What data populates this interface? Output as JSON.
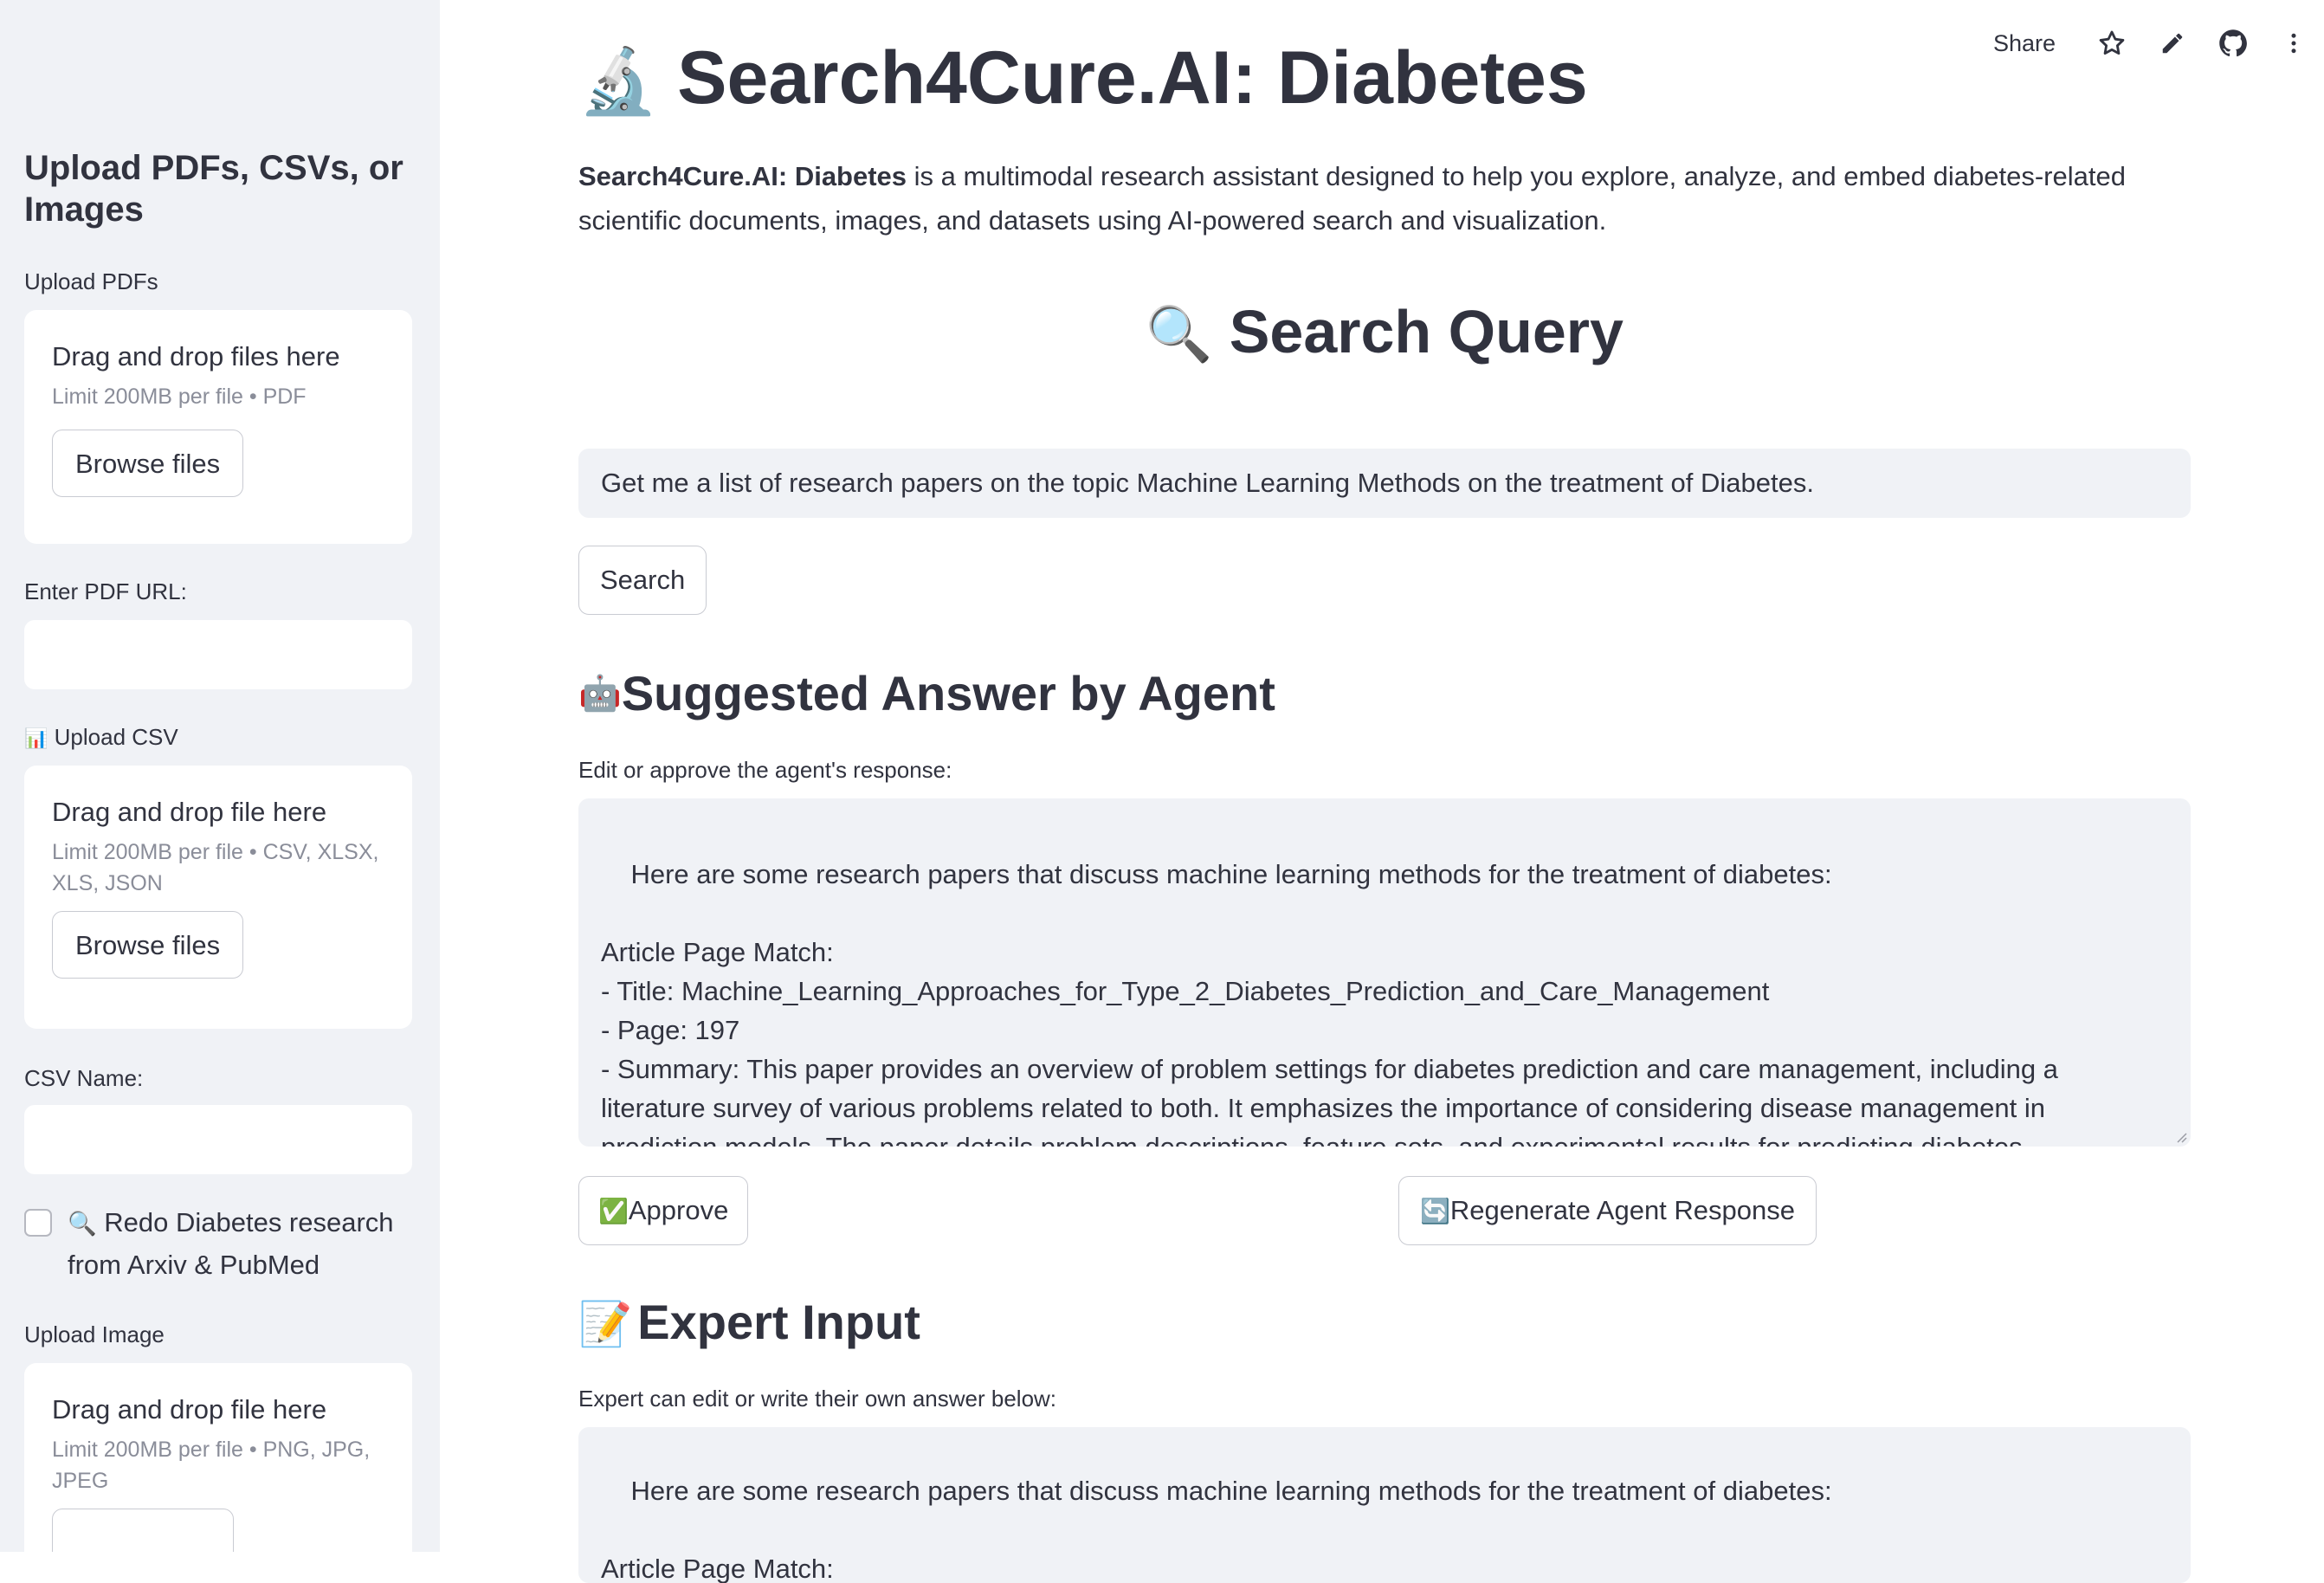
{
  "sidebar": {
    "heading": "Upload PDFs, CSVs, or Images",
    "pdf": {
      "label": "Upload PDFs",
      "drop_title": "Drag and drop files here",
      "limit": "Limit 200MB per file • PDF",
      "browse_label": "Browse files"
    },
    "pdf_url": {
      "label": "Enter PDF URL:",
      "value": ""
    },
    "csv": {
      "icon": "📊",
      "label": "Upload CSV",
      "drop_title": "Drag and drop file here",
      "limit": "Limit 200MB per file • CSV, XLSX, XLS, JSON",
      "browse_label": "Browse files"
    },
    "csv_name": {
      "label": "CSV Name:",
      "value": ""
    },
    "redo_checkbox": {
      "icon": "🔍",
      "label": "Redo Diabetes research from Arxiv & PubMed",
      "checked": false
    },
    "image": {
      "label": "Upload Image",
      "drop_title": "Drag and drop file here",
      "limit": "Limit 200MB per file • PNG, JPG, JPEG"
    }
  },
  "topbar": {
    "share_label": "Share",
    "icons": [
      "star-icon",
      "pencil-icon",
      "github-icon",
      "more-vertical-icon"
    ]
  },
  "main": {
    "title_icon": "🔬",
    "title": "Search4Cure.AI: Diabetes",
    "intro_bold": "Search4Cure.AI: Diabetes",
    "intro_rest": " is a multimodal research assistant designed to help you explore, analyze, and embed diabetes-related scientific documents, images, and datasets using AI-powered search and visualization.",
    "search_heading_icon": "🔍",
    "search_heading": "Search Query",
    "query_value": "Get me a list of research papers on the topic Machine Learning Methods on the treatment of Diabetes.",
    "search_button": "Search",
    "agent_heading_icon": "🤖",
    "agent_heading": "Suggested Answer by Agent",
    "agent_label": "Edit or approve the agent's response:",
    "agent_response": "Here are some research papers that discuss machine learning methods for the treatment of diabetes:\n\nArticle Page Match:\n- Title: Machine_Learning_Approaches_for_Type_2_Diabetes_Prediction_and_Care_Management\n- Page: 197\n- Summary: This paper provides an overview of problem settings for diabetes prediction and care management, including a literature survey of various problems related to both. It emphasizes the importance of considering disease management in prediction models. The paper details problem descriptions, feature sets, and experimental results for predicting diabetes complications, model calibration, optimization methods, baselines, model evaluation, and model results. The authors hope these results will serve as a foundation for",
    "approve_icon": "✅",
    "approve_button": "Approve",
    "regenerate_icon": "🔄",
    "regenerate_button": "Regenerate Agent Response",
    "expert_heading_icon": "📝",
    "expert_heading": "Expert Input",
    "expert_label": "Expert can edit or write their own answer below:",
    "expert_response": "Here are some research papers that discuss machine learning methods for the treatment of diabetes:\n\nArticle Page Match:"
  }
}
